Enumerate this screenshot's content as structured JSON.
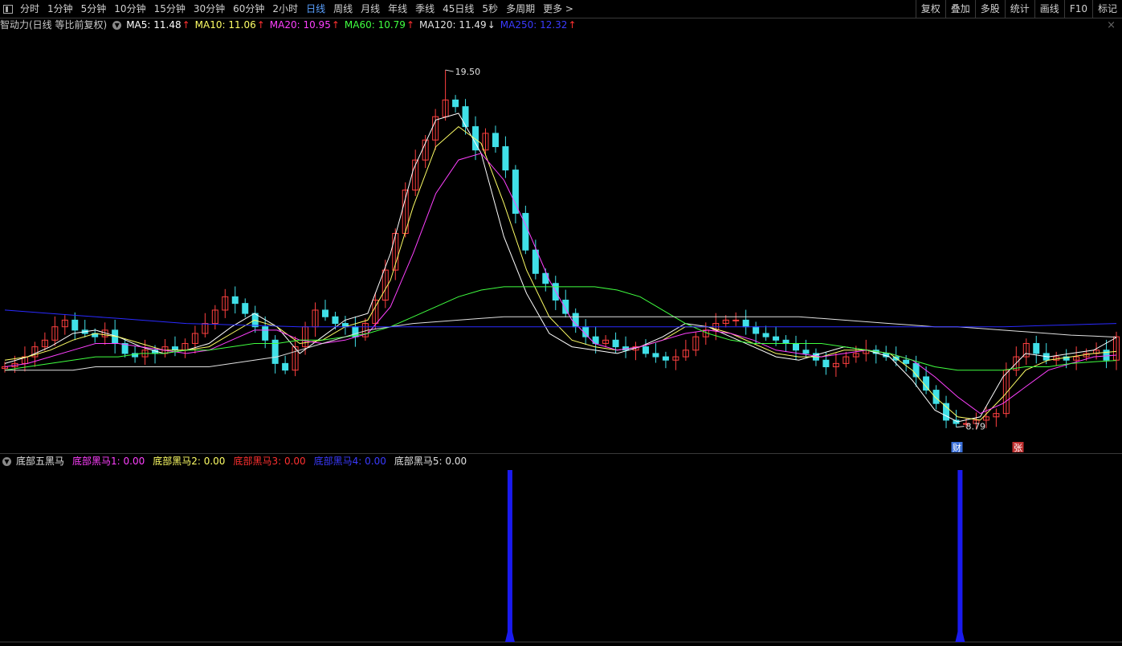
{
  "toolbar": {
    "periods": [
      "分时",
      "1分钟",
      "5分钟",
      "10分钟",
      "15分钟",
      "30分钟",
      "60分钟",
      "2小时",
      "日线",
      "周线",
      "月线",
      "年线",
      "季线",
      "45日线",
      "5秒",
      "多周期",
      "更多 >"
    ],
    "active_period": "日线",
    "tools": [
      "复权",
      "叠加",
      "多股",
      "统计",
      "画线",
      "F10",
      "标记"
    ]
  },
  "main_panel": {
    "indicator_name": "智动力(日线 等比前复权)",
    "ma": [
      {
        "label": "MA5: 11.48",
        "color": "#ffffff",
        "trend": "up"
      },
      {
        "label": "MA10: 11.06",
        "color": "#ffff66",
        "trend": "up"
      },
      {
        "label": "MA20: 10.95",
        "color": "#ff40ff",
        "trend": "up"
      },
      {
        "label": "MA60: 10.79",
        "color": "#40ff40",
        "trend": "up"
      },
      {
        "label": "MA120: 11.49",
        "color": "#e0e0e0",
        "trend": "down"
      },
      {
        "label": "MA250: 12.32",
        "color": "#3a3aff",
        "trend": "up"
      }
    ],
    "high_label": "19.50",
    "low_label": "8.79",
    "event_badges": [
      {
        "text": "财",
        "color": "#3a6fd8"
      },
      {
        "text": "张",
        "color": "#c03030"
      }
    ],
    "close_symbol": "×"
  },
  "sub_panel": {
    "name": "底部五黑马",
    "lines": [
      {
        "label": "底部黑马1: 0.00",
        "color": "#ff40ff"
      },
      {
        "label": "底部黑马2: 0.00",
        "color": "#ffff66"
      },
      {
        "label": "底部黑马3: 0.00",
        "color": "#ff3030"
      },
      {
        "label": "底部黑马4: 0.00",
        "color": "#3a3aff"
      },
      {
        "label": "底部黑马5: 0.00",
        "color": "#e0e0e0"
      }
    ]
  },
  "colors": {
    "up": "#ff4040",
    "down": "#40e0e8",
    "ma5": "#ffffff",
    "ma10": "#ffff66",
    "ma20": "#ff40ff",
    "ma60": "#40ff40",
    "ma120": "#e0e0e0",
    "ma250": "#2a2aff",
    "signal": "#1a1aee"
  },
  "chart_data": [
    {
      "type": "candlestick",
      "title": "智动力(日线 等比前复权)",
      "ylim": [
        8.3,
        20.2
      ],
      "price_high": 19.5,
      "price_low": 8.79,
      "close_approx": [
        10.6,
        10.7,
        10.9,
        11.2,
        11.4,
        11.8,
        12.0,
        11.7,
        11.6,
        11.5,
        11.7,
        11.3,
        11.0,
        10.9,
        11.1,
        11.0,
        11.2,
        11.1,
        11.3,
        11.6,
        11.9,
        12.3,
        12.7,
        12.5,
        12.2,
        11.8,
        11.4,
        10.7,
        10.5,
        11.2,
        11.8,
        12.3,
        12.1,
        11.9,
        11.8,
        11.5,
        11.9,
        12.6,
        13.5,
        14.6,
        15.9,
        16.8,
        17.4,
        18.1,
        18.6,
        18.4,
        17.8,
        17.1,
        17.6,
        17.2,
        16.5,
        15.2,
        14.1,
        13.4,
        13.1,
        12.6,
        12.2,
        11.8,
        11.5,
        11.3,
        11.4,
        11.2,
        11.1,
        11.2,
        11.0,
        10.9,
        10.8,
        10.9,
        11.1,
        11.5,
        11.7,
        11.9,
        12.0,
        12.0,
        11.8,
        11.6,
        11.5,
        11.4,
        11.3,
        11.1,
        11.0,
        10.8,
        10.6,
        10.7,
        10.9,
        11.0,
        11.1,
        11.0,
        10.9,
        10.8,
        10.7,
        10.3,
        9.9,
        9.5,
        9.0,
        8.9,
        8.9,
        9.0,
        9.1,
        9.2,
        10.5,
        10.9,
        11.3,
        11.0,
        10.8,
        10.9,
        10.8,
        10.9,
        11.0,
        11.1,
        10.8,
        11.5
      ],
      "ma": {
        "MA5": [
          10.7,
          10.9,
          11.2,
          11.6,
          11.7,
          11.5,
          11.2,
          11.0,
          11.1,
          11.3,
          11.8,
          12.2,
          11.8,
          11.0,
          11.5,
          12.0,
          12.2,
          14.0,
          16.5,
          18.0,
          18.2,
          17.0,
          14.5,
          12.8,
          11.6,
          11.2,
          11.1,
          11.0,
          11.2,
          11.5,
          11.9,
          11.8,
          11.5,
          11.2,
          10.9,
          10.8,
          11.0,
          11.2,
          11.1,
          10.9,
          10.2,
          9.3,
          8.95,
          9.1,
          10.3,
          11.0,
          10.9,
          11.0,
          11.1,
          11.48
        ],
        "MA10": [
          10.8,
          10.9,
          11.1,
          11.4,
          11.6,
          11.5,
          11.3,
          11.1,
          11.1,
          11.2,
          11.6,
          12.0,
          11.8,
          11.3,
          11.4,
          11.8,
          12.0,
          13.2,
          15.4,
          17.2,
          17.8,
          17.3,
          15.5,
          13.5,
          12.1,
          11.4,
          11.2,
          11.1,
          11.2,
          11.4,
          11.8,
          11.8,
          11.6,
          11.3,
          11.0,
          10.9,
          10.9,
          11.1,
          11.1,
          11.0,
          10.5,
          9.7,
          9.1,
          9.0,
          9.7,
          10.5,
          10.8,
          10.9,
          11.0,
          11.06
        ],
        "MA20": [
          10.6,
          10.7,
          10.9,
          11.1,
          11.3,
          11.3,
          11.2,
          11.1,
          11.0,
          11.1,
          11.4,
          11.7,
          11.7,
          11.4,
          11.3,
          11.4,
          11.6,
          12.4,
          14.0,
          15.8,
          16.8,
          17.0,
          16.2,
          14.8,
          13.2,
          12.0,
          11.3,
          11.1,
          11.2,
          11.4,
          11.6,
          11.7,
          11.6,
          11.4,
          11.1,
          11.0,
          10.9,
          11.0,
          11.1,
          11.0,
          10.8,
          10.3,
          9.7,
          9.2,
          9.5,
          10.0,
          10.5,
          10.7,
          10.9,
          10.95
        ],
        "MA60": [
          10.5,
          10.6,
          10.7,
          10.8,
          10.9,
          10.9,
          11.0,
          11.0,
          11.1,
          11.1,
          11.2,
          11.3,
          11.3,
          11.4,
          11.4,
          11.5,
          11.6,
          11.8,
          12.1,
          12.4,
          12.7,
          12.9,
          13.0,
          13.0,
          13.0,
          13.0,
          13.0,
          12.9,
          12.7,
          12.3,
          11.9,
          11.6,
          11.4,
          11.3,
          11.3,
          11.3,
          11.3,
          11.2,
          11.1,
          11.0,
          10.8,
          10.6,
          10.5,
          10.5,
          10.5,
          10.6,
          10.6,
          10.7,
          10.75,
          10.79
        ],
        "MA120": [
          10.5,
          10.5,
          10.5,
          10.5,
          10.6,
          10.6,
          10.6,
          10.6,
          10.6,
          10.6,
          10.7,
          10.8,
          10.9,
          11.1,
          11.3,
          11.5,
          11.7,
          11.8,
          11.9,
          11.95,
          12.0,
          12.05,
          12.1,
          12.1,
          12.1,
          12.1,
          12.1,
          12.1,
          12.1,
          12.1,
          12.1,
          12.1,
          12.1,
          12.1,
          12.1,
          12.1,
          12.05,
          12.0,
          11.95,
          11.9,
          11.85,
          11.8,
          11.8,
          11.75,
          11.7,
          11.65,
          11.6,
          11.55,
          11.52,
          11.49
        ],
        "MA250": [
          12.3,
          12.25,
          12.2,
          12.15,
          12.1,
          12.05,
          12.0,
          11.95,
          11.9,
          11.88,
          11.86,
          11.84,
          11.82,
          11.8,
          11.8,
          11.8,
          11.8,
          11.8,
          11.8,
          11.8,
          11.8,
          11.8,
          11.8,
          11.8,
          11.8,
          11.8,
          11.8,
          11.8,
          11.8,
          11.8,
          11.8,
          11.8,
          11.8,
          11.8,
          11.8,
          11.8,
          11.8,
          11.8,
          11.8,
          11.8,
          11.8,
          11.8,
          11.8,
          11.8,
          11.8,
          11.82,
          11.84,
          11.86,
          11.88,
          11.9
        ]
      }
    },
    {
      "type": "bar",
      "title": "底部五黑马",
      "signal_positions": [
        0.4545,
        0.8557
      ],
      "signal_value": 1
    }
  ]
}
